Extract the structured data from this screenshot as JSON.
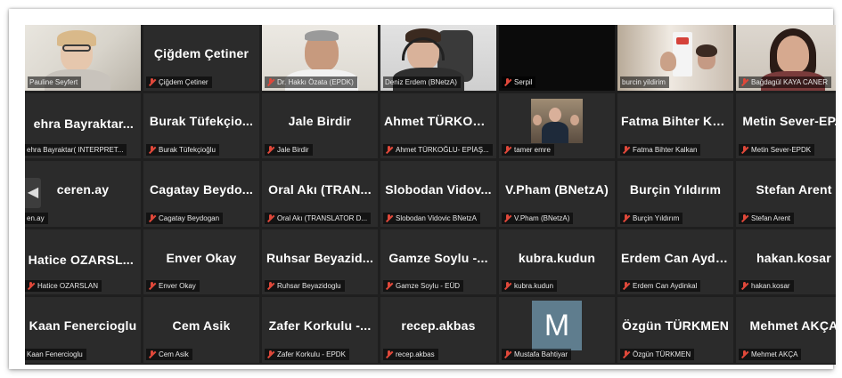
{
  "meeting": {
    "navigation": {
      "prev_icon": "chevron-left-icon",
      "prev_glyph": "◀"
    },
    "colors": {
      "tile_bg": "#2b2b2b",
      "active_speaker": "#c9d94a",
      "mic_muted": "#e0483a",
      "avatar_bg": "#5f7d8e"
    },
    "participants": [
      {
        "display": "",
        "caption": "Pauline Seyfert",
        "muted": false,
        "video": true
      },
      {
        "display": "Çiğdem Çetiner",
        "caption": "Çiğdem Çetiner",
        "muted": true,
        "video": false
      },
      {
        "display": "",
        "caption": "Dr. Hakkı Özata (EPDK)",
        "muted": true,
        "video": true
      },
      {
        "display": "",
        "caption": "Deniz Erdem (BNetzA)",
        "muted": false,
        "video": true,
        "speaking": true
      },
      {
        "display": "",
        "caption": "Serpil",
        "muted": true,
        "video": true
      },
      {
        "display": "",
        "caption": "burcin yildirim",
        "muted": false,
        "video": true
      },
      {
        "display": "",
        "caption": "Bağdagül KAYA CANER",
        "muted": true,
        "video": true
      },
      {
        "display": "ehra Bayraktar...",
        "caption": "ehra Bayraktar( INTERPRET...",
        "muted": false,
        "video": false
      },
      {
        "display": "Burak Tüfekçio...",
        "caption": "Burak Tüfekçioğlu",
        "muted": true,
        "video": false
      },
      {
        "display": "Jale Birdir",
        "caption": "Jale Birdir",
        "muted": true,
        "video": false
      },
      {
        "display": "Ahmet TÜRKOĞ...",
        "caption": "Ahmet TÜRKOĞLU- EPİAŞ...",
        "muted": true,
        "video": false
      },
      {
        "display": "",
        "caption": "tamer emre",
        "muted": true,
        "video": false,
        "photo": true
      },
      {
        "display": "Fatma Bihter Ka...",
        "caption": "Fatma Bihter Kalkan",
        "muted": true,
        "video": false
      },
      {
        "display": "Metin Sever-EP...",
        "caption": "Metin Sever-EPDK",
        "muted": true,
        "video": false
      },
      {
        "display": "ceren.ay",
        "caption": "en.ay",
        "muted": false,
        "video": false
      },
      {
        "display": "Cagatay Beydo...",
        "caption": "Cagatay Beydogan",
        "muted": true,
        "video": false
      },
      {
        "display": "Oral Akı (TRAN...",
        "caption": "Oral Akı (TRANSLATOR D...",
        "muted": true,
        "video": false
      },
      {
        "display": "Slobodan Vidov...",
        "caption": "Slobodan Vidovic BNetzA",
        "muted": true,
        "video": false
      },
      {
        "display": "V.Pham (BNetzA)",
        "caption": "V.Pham (BNetzA)",
        "muted": true,
        "video": false
      },
      {
        "display": "Burçin Yıldırım",
        "caption": "Burçin Yıldırım",
        "muted": true,
        "video": false
      },
      {
        "display": "Stefan Arent",
        "caption": "Stefan Arent",
        "muted": true,
        "video": false
      },
      {
        "display": "Hatice OZARSL...",
        "caption": "Hatice OZARSLAN",
        "muted": true,
        "video": false
      },
      {
        "display": "Enver Okay",
        "caption": "Enver Okay",
        "muted": true,
        "video": false
      },
      {
        "display": "Ruhsar Beyazid...",
        "caption": "Ruhsar Beyazidoglu",
        "muted": true,
        "video": false
      },
      {
        "display": "Gamze Soylu -...",
        "caption": "Gamze Soylu - EÜD",
        "muted": true,
        "video": false
      },
      {
        "display": "kubra.kudun",
        "caption": "kubra.kudun",
        "muted": true,
        "video": false
      },
      {
        "display": "Erdem Can Aydi...",
        "caption": "Erdem Can Aydinkal",
        "muted": true,
        "video": false
      },
      {
        "display": "hakan.kosar",
        "caption": "hakan.kosar",
        "muted": true,
        "video": false
      },
      {
        "display": "Kaan Fenercioglu",
        "caption": "Kaan Fenercioglu",
        "muted": false,
        "video": false
      },
      {
        "display": "Cem Asik",
        "caption": "Cem Asik",
        "muted": true,
        "video": false
      },
      {
        "display": "Zafer Korkulu -...",
        "caption": "Zafer Korkulu - EPDK",
        "muted": true,
        "video": false
      },
      {
        "display": "recep.akbas",
        "caption": "recep.akbas",
        "muted": true,
        "video": false
      },
      {
        "display": "M",
        "caption": "Mustafa Bahtiyar",
        "muted": true,
        "video": false,
        "avatar": true
      },
      {
        "display": "Özgün TÜRKMEN",
        "caption": "Özgün TÜRKMEN",
        "muted": true,
        "video": false
      },
      {
        "display": "Mehmet AKÇA",
        "caption": "Mehmet AKÇA",
        "muted": true,
        "video": false
      }
    ]
  }
}
